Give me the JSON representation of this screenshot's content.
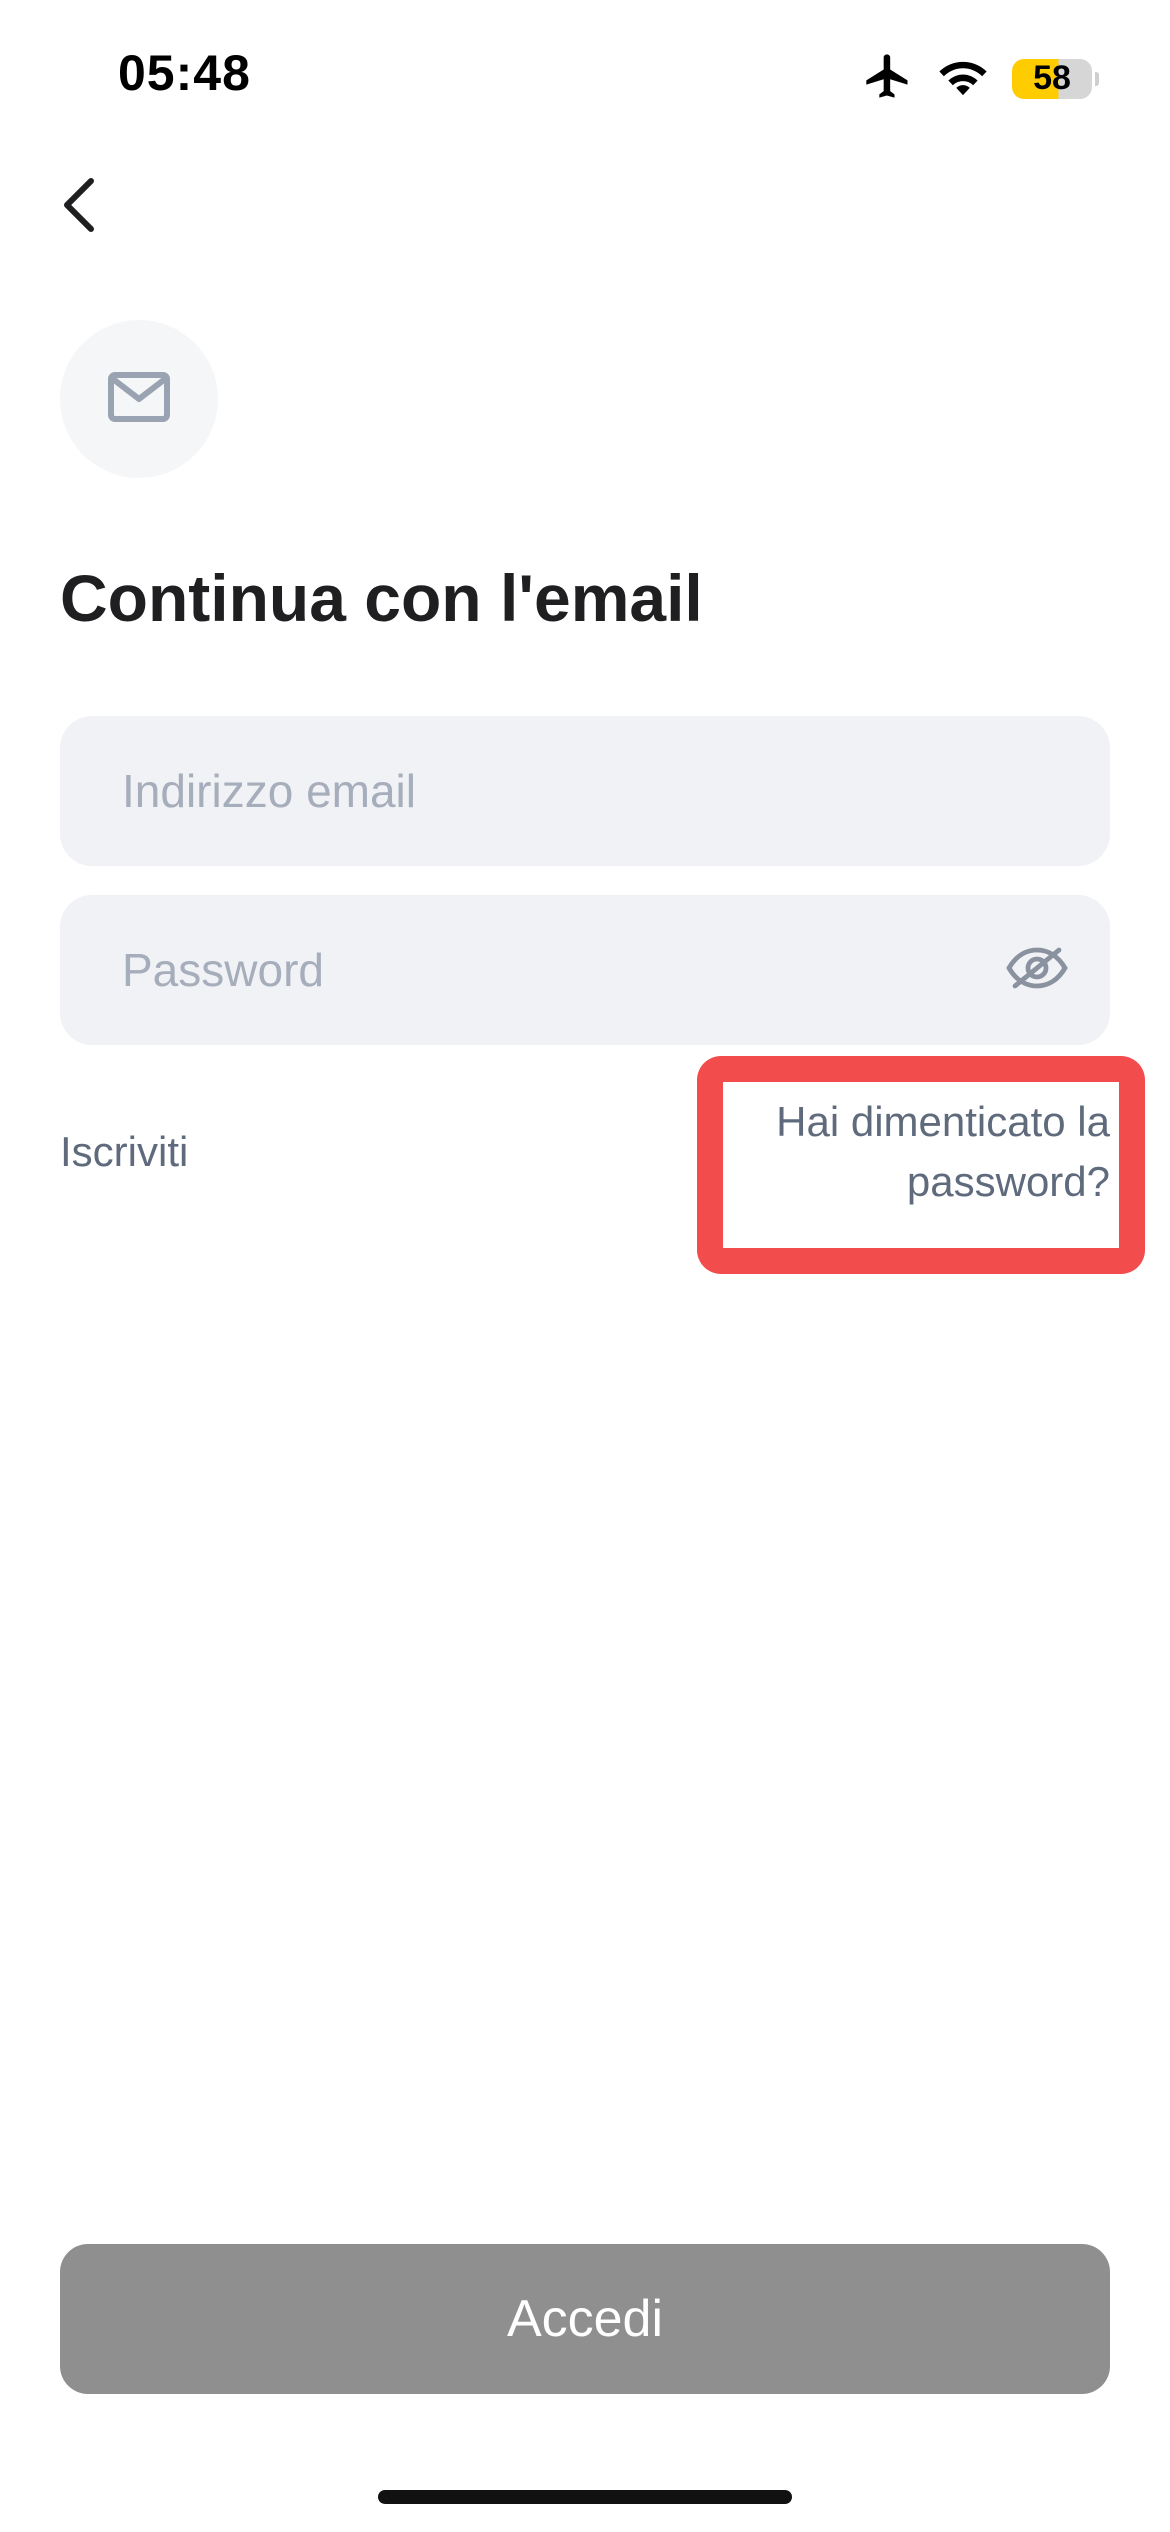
{
  "status_bar": {
    "time": "05:48",
    "battery": "58",
    "icons": [
      "airplane-icon",
      "wifi-icon",
      "battery-icon"
    ],
    "battery_color": "#ffcc00"
  },
  "header": {
    "back_icon": "chevron-left-icon"
  },
  "hero": {
    "icon": "mail-icon",
    "title": "Continua con l'email"
  },
  "form": {
    "email": {
      "placeholder": "Indirizzo email",
      "value": ""
    },
    "password": {
      "placeholder": "Password",
      "value": "",
      "toggle_icon": "eye-off-icon"
    }
  },
  "links": {
    "signup": "Iscriviti",
    "forgot_password": "Hai dimenticato la password?"
  },
  "actions": {
    "login": "Accedi"
  },
  "colors": {
    "highlight": "#f24c4c",
    "button_disabled": "#8f8f8f",
    "field_bg": "#f1f2f6",
    "link": "#5f6b7d"
  }
}
